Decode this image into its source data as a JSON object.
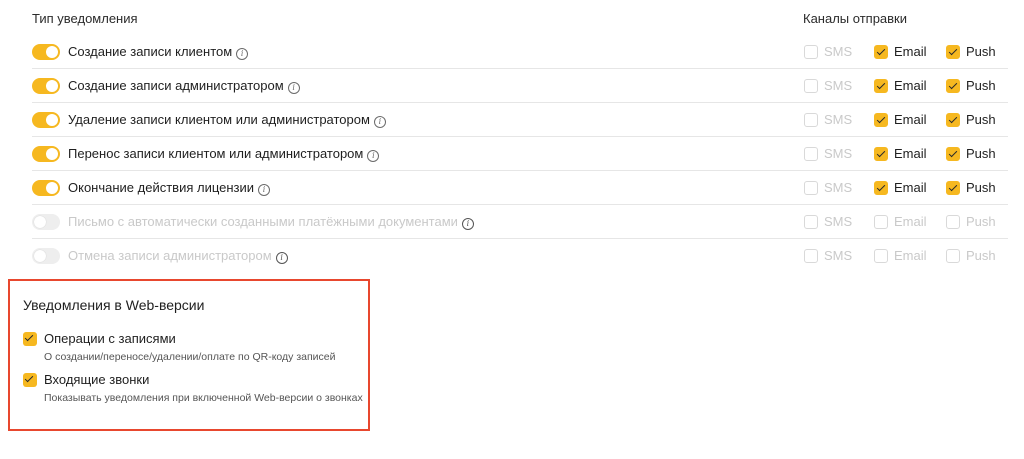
{
  "headers": {
    "type": "Тип уведомления",
    "channels": "Каналы отправки"
  },
  "rows": [
    {
      "label": "Создание записи клиентом",
      "enabled": true,
      "sms": "SMS",
      "email": "Email",
      "push": "Push",
      "sms_checked": false,
      "email_checked": true,
      "push_checked": true
    },
    {
      "label": "Создание записи администратором",
      "enabled": true,
      "sms": "SMS",
      "email": "Email",
      "push": "Push",
      "sms_checked": false,
      "email_checked": true,
      "push_checked": true
    },
    {
      "label": "Удаление записи клиентом или администратором",
      "enabled": true,
      "sms": "SMS",
      "email": "Email",
      "push": "Push",
      "sms_checked": false,
      "email_checked": true,
      "push_checked": true
    },
    {
      "label": "Перенос записи клиентом или администратором",
      "enabled": true,
      "sms": "SMS",
      "email": "Email",
      "push": "Push",
      "sms_checked": false,
      "email_checked": true,
      "push_checked": true
    },
    {
      "label": "Окончание действия лицензии",
      "enabled": true,
      "sms": "SMS",
      "email": "Email",
      "push": "Push",
      "sms_checked": false,
      "email_checked": true,
      "push_checked": true
    },
    {
      "label": "Письмо с автоматически созданными платёжными документами",
      "enabled": false,
      "sms": "SMS",
      "email": "Email",
      "push": "Push",
      "sms_checked": false,
      "email_checked": false,
      "push_checked": false
    },
    {
      "label": "Отмена записи администратором",
      "enabled": false,
      "sms": "SMS",
      "email": "Email",
      "push": "Push",
      "sms_checked": false,
      "email_checked": false,
      "push_checked": false
    }
  ],
  "web": {
    "title": "Уведомления в Web-версии",
    "items": [
      {
        "label": "Операции с записями",
        "description": "О создании/переносе/удалении/оплате по QR-коду записей",
        "checked": true
      },
      {
        "label": "Входящие звонки",
        "description": "Показывать уведомления при включенной Web-версии о звонках",
        "checked": true
      }
    ]
  },
  "colors": {
    "accent": "#f6b820",
    "highlight_border": "#e8472e"
  }
}
